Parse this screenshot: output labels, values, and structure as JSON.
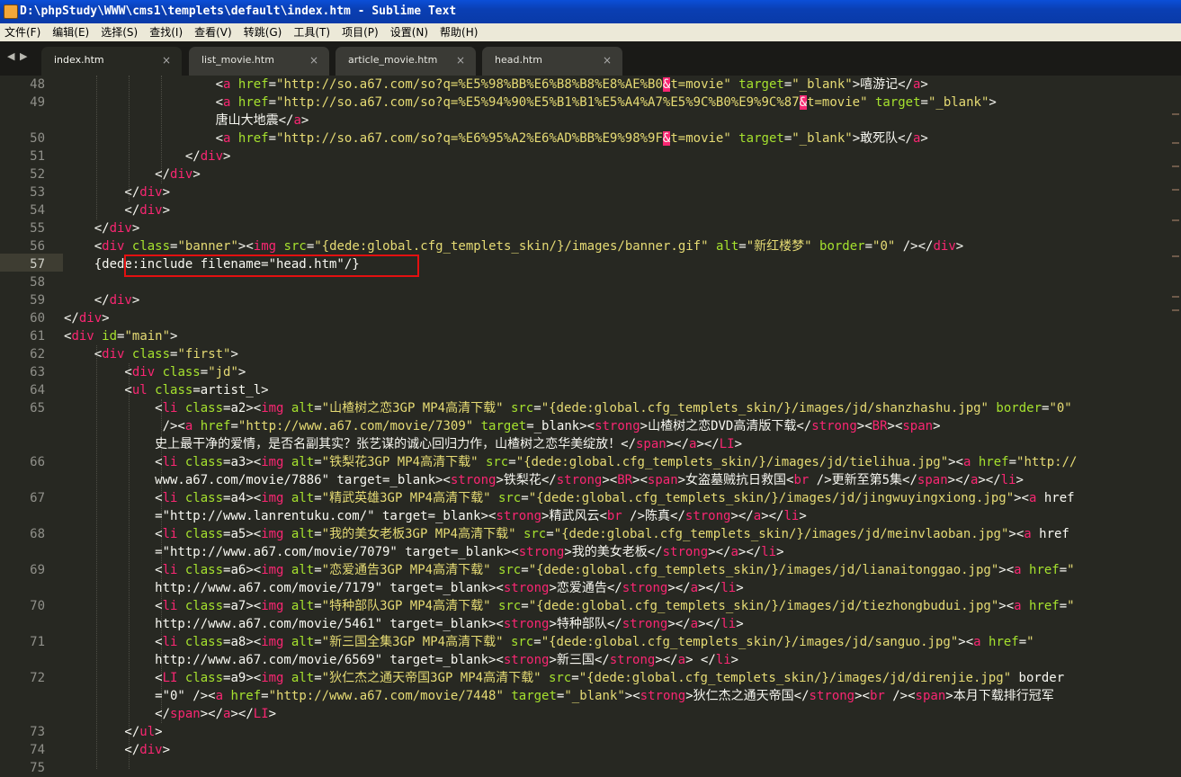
{
  "window": {
    "title": "D:\\phpStudy\\WWW\\cms1\\templets\\default\\index.htm - Sublime Text"
  },
  "menu": [
    "文件(F)",
    "编辑(E)",
    "选择(S)",
    "查找(I)",
    "查看(V)",
    "转跳(G)",
    "工具(T)",
    "项目(P)",
    "设置(N)",
    "帮助(H)"
  ],
  "tabs": [
    {
      "label": "index.htm",
      "active": true
    },
    {
      "label": "list_movie.htm",
      "active": false
    },
    {
      "label": "article_movie.htm",
      "active": false
    },
    {
      "label": "head.htm",
      "active": false
    }
  ],
  "editor": {
    "current_line": "57",
    "line_numbers": [
      "48",
      "49",
      "50",
      "51",
      "52",
      "53",
      "54",
      "55",
      "56",
      "57",
      "58",
      "59",
      "60",
      "61",
      "62",
      "63",
      "64",
      "65",
      "66",
      "67",
      "68",
      "69",
      "70",
      "71",
      "72",
      "73",
      "74",
      "75"
    ],
    "highlight_text": "{dede:include filename=\"head.htm\"/}",
    "code": [
      "                    <a href=\"http://so.a67.com/so?q=%E5%98%BB%E6%B8%B8%E8%AE%B0&t=movie\" target=\"_blank\">嘻游记</a>",
      "                    <a href=\"http://so.a67.com/so?q=%E5%94%90%E5%B1%B1%E5%A4%A7%E5%9C%B0%E9%9C%87&t=movie\" target=\"_blank\">",
      "                    唐山大地震</a>",
      "                    <a href=\"http://so.a67.com/so?q=%E6%95%A2%E6%AD%BB%E9%98%9F&t=movie\" target=\"_blank\">敢死队</a>",
      "                </div>",
      "            </div>",
      "        </div>",
      "        </div>",
      "    </div>",
      "    <div class=\"banner\"><img src=\"{dede:global.cfg_templets_skin/}/images/banner.gif\" alt=\"新红楼梦\" border=\"0\" /></div>",
      "    {dede:include filename=\"head.htm\"/}",
      "",
      "    </div>",
      "</div>",
      "<div id=\"main\">",
      "    <div class=\"first\">",
      "        <div class=\"jd\">",
      "        <ul class=artist_l>",
      "            <li class=a2><img alt=\"山楂树之恋3GP MP4高清下载\" src=\"{dede:global.cfg_templets_skin/}/images/jd/shanzhashu.jpg\" border=\"0\"",
      "             /><a href=\"http://www.a67.com/movie/7309\" target=_blank><strong>山楂树之恋DVD高清版下载</strong><BR><span>",
      "            史上最干净的爱情，是否名副其实？张艺谋的诚心回归力作，山楂树之恋华美绽放！</span></a></LI>",
      "            <li class=a3><img alt=\"铁梨花3GP MP4高清下载\" src=\"{dede:global.cfg_templets_skin/}/images/jd/tielihua.jpg\"><a href=\"http://",
      "            www.a67.com/movie/7886\" target=_blank><strong>铁梨花</strong><BR><span>女盗墓贼抗日救国<br />更新至第5集</span></a></li>",
      "            <li class=a4><img alt=\"精武英雄3GP MP4高清下载\" src=\"{dede:global.cfg_templets_skin/}/images/jd/jingwuyingxiong.jpg\"><a href",
      "            =\"http://www.lanrentuku.com/\" target=_blank><strong>精武风云<br />陈真</strong></a></li>",
      "            <li class=a5><img alt=\"我的美女老板3GP MP4高清下载\" src=\"{dede:global.cfg_templets_skin/}/images/jd/meinvlaoban.jpg\"><a href",
      "            =\"http://www.a67.com/movie/7079\" target=_blank><strong>我的美女老板</strong></a></li>",
      "            <li class=a6><img alt=\"恋爱通告3GP MP4高清下载\" src=\"{dede:global.cfg_templets_skin/}/images/jd/lianaitonggao.jpg\"><a href=\"",
      "            http://www.a67.com/movie/7179\" target=_blank><strong>恋爱通告</strong></a></li>",
      "            <li class=a7><img alt=\"特种部队3GP MP4高清下载\" src=\"{dede:global.cfg_templets_skin/}/images/jd/tiezhongbudui.jpg\"><a href=\"",
      "            http://www.a67.com/movie/5461\" target=_blank><strong>特种部队</strong></a></li>",
      "            <li class=a8><img alt=\"新三国全集3GP MP4高清下载\" src=\"{dede:global.cfg_templets_skin/}/images/jd/sanguo.jpg\"><a href=\"",
      "            http://www.a67.com/movie/6569\" target=_blank><strong>新三国</strong></a> </li>",
      "            <LI class=a9><img alt=\"狄仁杰之通天帝国3GP MP4高清下载\" src=\"{dede:global.cfg_templets_skin/}/images/jd/direnjie.jpg\" border",
      "            =\"0\" /><a href=\"http://www.a67.com/movie/7448\" target=\"_blank\"><strong>狄仁杰之通天帝国</strong><br /><span>本月下载排行冠军",
      "            </span></a></LI>",
      "        </ul>",
      "        </div>"
    ]
  },
  "colors": {
    "background": "#272822",
    "tag": "#f92672",
    "attribute": "#a6e22e",
    "string": "#e6db74",
    "text": "#f8f8f2",
    "highlight_box": "#e31010"
  }
}
